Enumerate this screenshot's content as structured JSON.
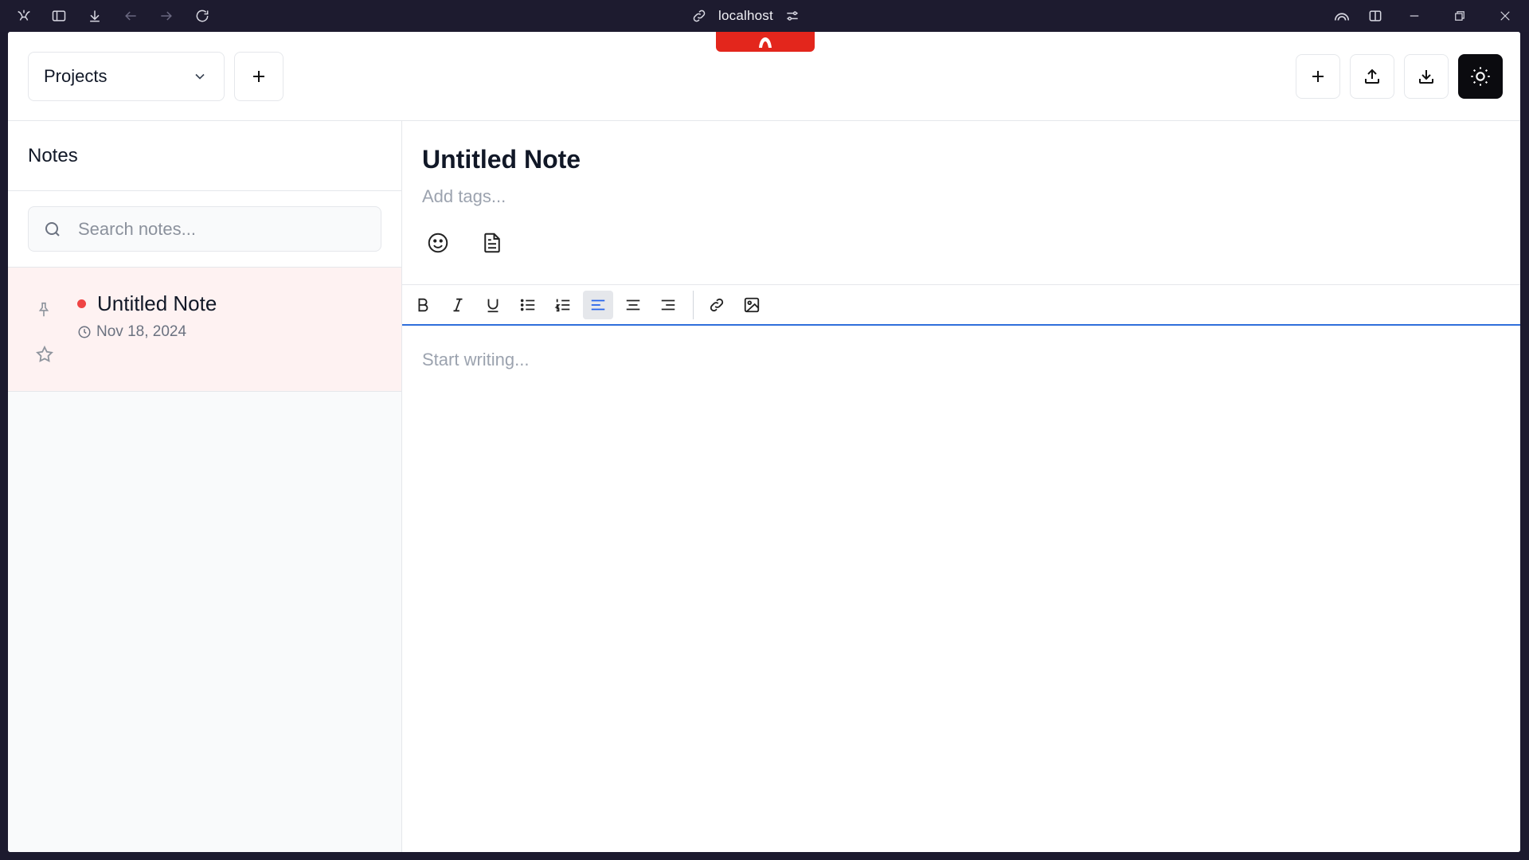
{
  "browser": {
    "url": "localhost"
  },
  "header": {
    "project_select": "Projects"
  },
  "sidebar": {
    "title": "Notes",
    "search_placeholder": "Search notes...",
    "notes": [
      {
        "title": "Untitled Note",
        "date": "Nov 18, 2024",
        "status_color": "#ef4444"
      }
    ]
  },
  "editor": {
    "title": "Untitled Note",
    "tags_placeholder": "Add tags...",
    "body_placeholder": "Start writing...",
    "toolbar": [
      "bold-icon",
      "italic-icon",
      "underline-icon",
      "bullet-list-icon",
      "ordered-list-icon",
      "align-left-icon",
      "align-center-icon",
      "align-right-icon",
      "link-icon",
      "image-icon"
    ],
    "active_tool": "align-left-icon"
  },
  "colors": {
    "accent": "#2f6fdb",
    "dev_badge": "#e3261c",
    "selected_note_bg": "#fef2f2"
  }
}
